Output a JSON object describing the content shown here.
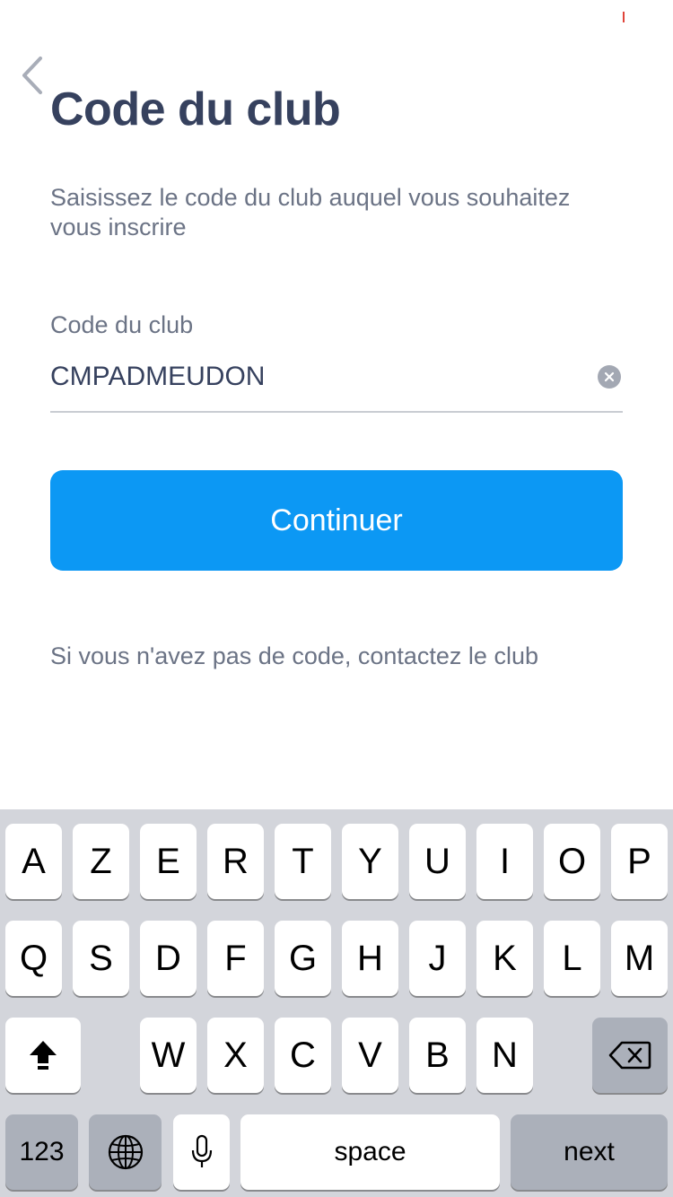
{
  "header": {
    "back_icon": "chevron-left-icon",
    "title": "Code du club"
  },
  "form": {
    "instructions": "Saisissez le code du club auquel vous souhaitez vous inscrire",
    "field_label": "Code du club",
    "field_value": "CMPADMEUDON",
    "clear_icon": "clear-circle-icon",
    "continue_label": "Continuer",
    "help_text": "Si vous n'avez pas de code, contactez le club"
  },
  "keyboard": {
    "row1": [
      "A",
      "Z",
      "E",
      "R",
      "T",
      "Y",
      "U",
      "I",
      "O",
      "P"
    ],
    "row2": [
      "Q",
      "S",
      "D",
      "F",
      "G",
      "H",
      "J",
      "K",
      "L",
      "M"
    ],
    "row3": [
      "W",
      "X",
      "C",
      "V",
      "B",
      "N"
    ],
    "shift_icon": "shift-icon",
    "delete_icon": "backspace-icon",
    "numbers_label": "123",
    "globe_icon": "globe-icon",
    "mic_icon": "microphone-icon",
    "space_label": "space",
    "return_label": "next"
  },
  "colors": {
    "title": "#36415e",
    "secondary_text": "#6b7385",
    "primary_button": "#0c98f4",
    "keyboard_bg": "#d3d5db",
    "key_dark": "#abb0ba"
  }
}
